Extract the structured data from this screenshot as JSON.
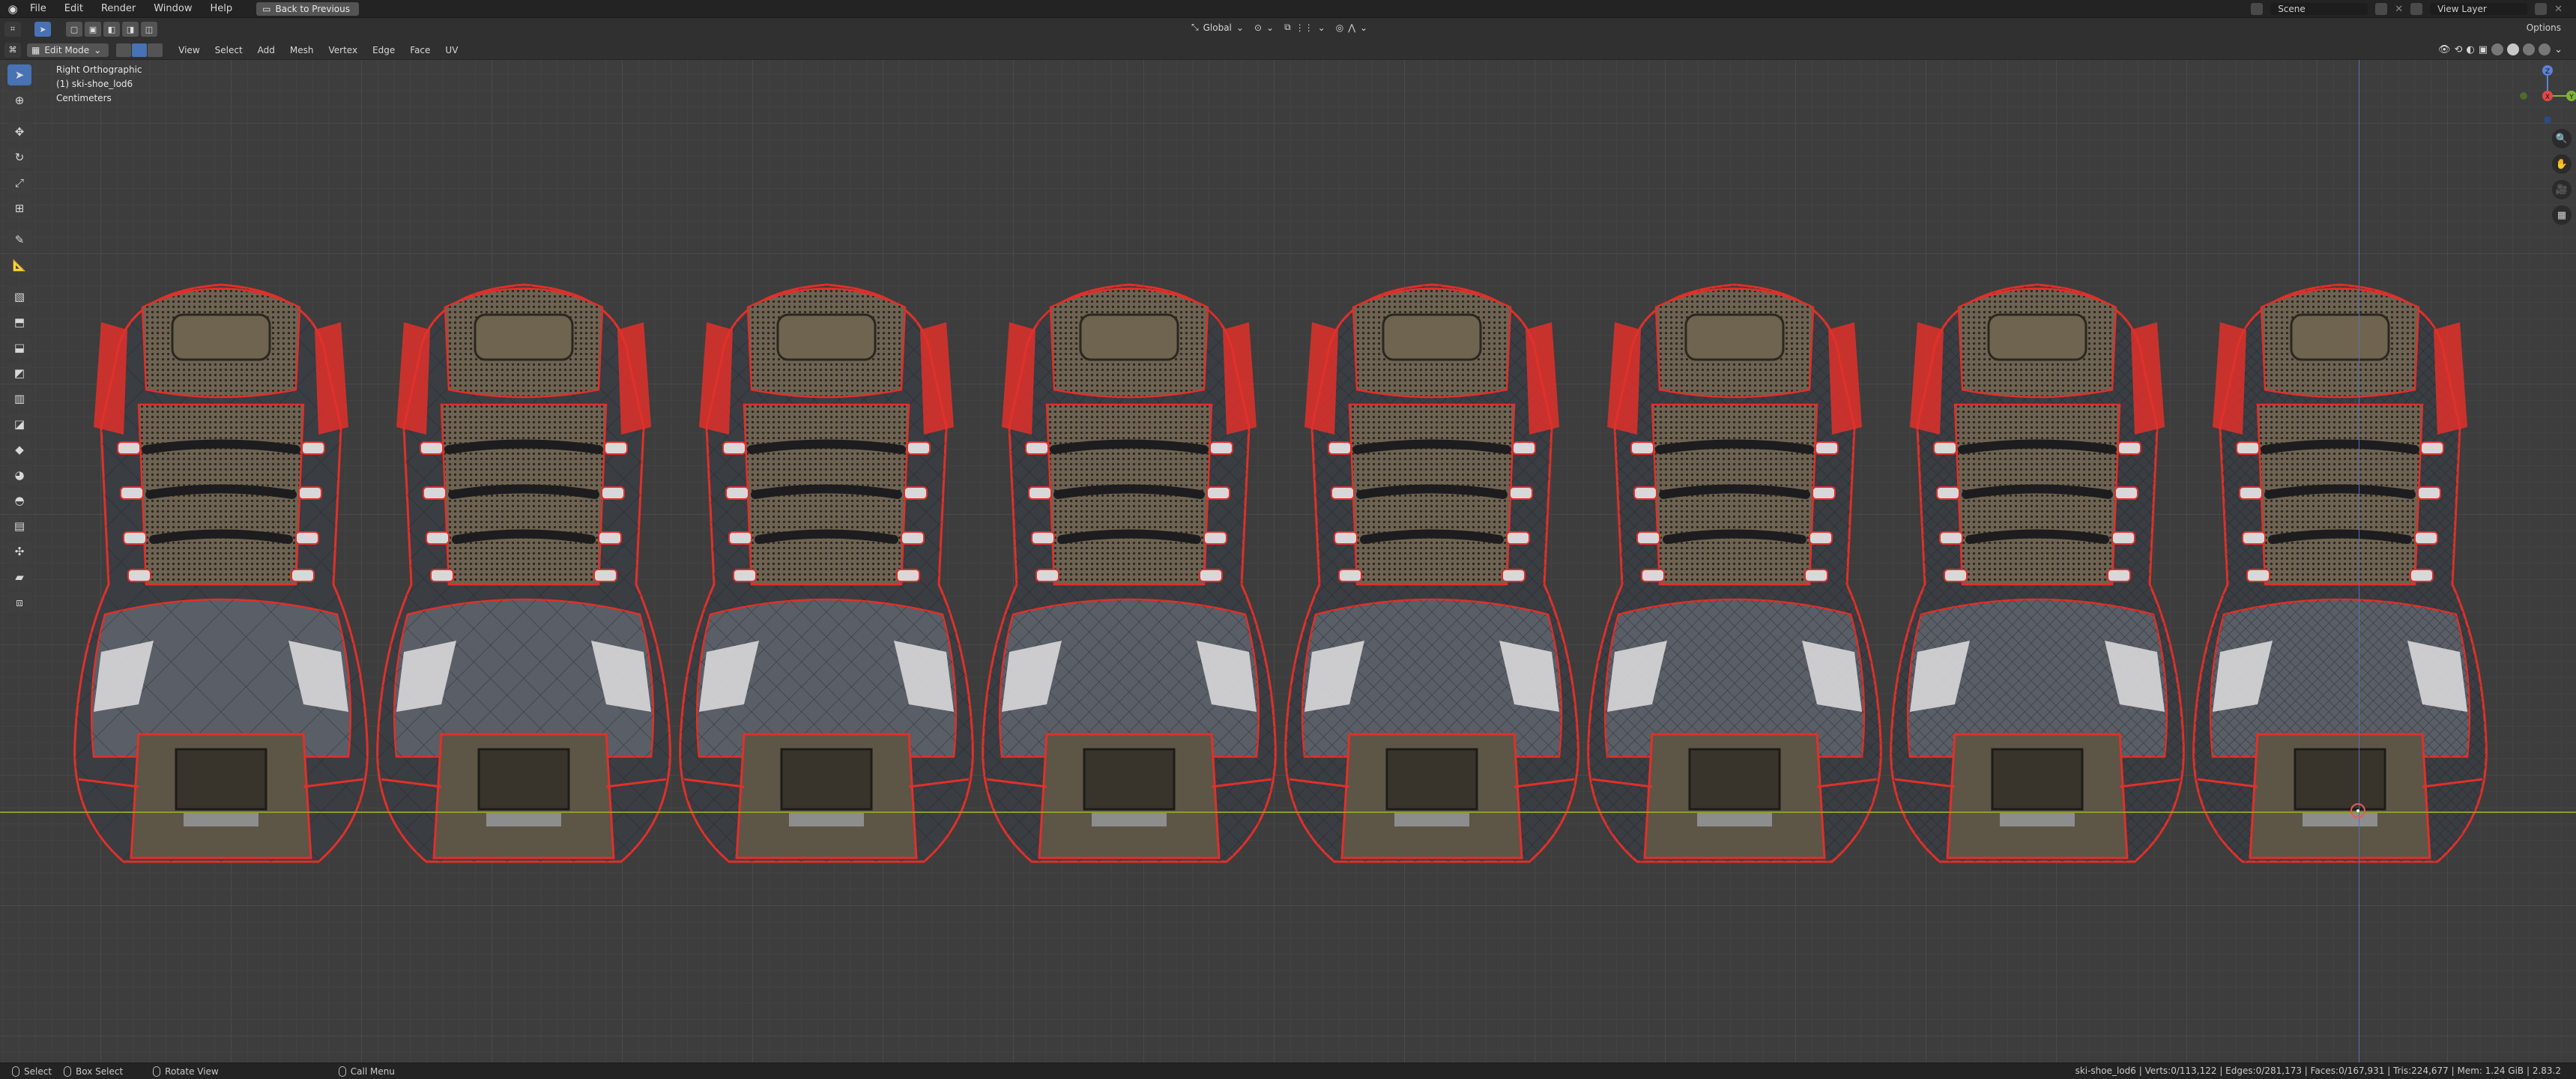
{
  "topbar": {
    "menus": [
      "File",
      "Edit",
      "Render",
      "Window",
      "Help"
    ],
    "back_button": "Back to Previous",
    "scene_label": "Scene",
    "view_layer_label": "View Layer"
  },
  "header1": {
    "transform_orientation": "Global",
    "options_label": "Options"
  },
  "header2": {
    "mode_label": "Edit Mode",
    "menus": [
      "View",
      "Select",
      "Add",
      "Mesh",
      "Vertex",
      "Edge",
      "Face",
      "UV"
    ]
  },
  "viewport": {
    "view_name": "Right Orthographic",
    "object_name": "(1) ski-shoe_lod6",
    "units": "Centimeters"
  },
  "gizmo": {
    "x_label": "X",
    "y_label": "Y",
    "z_label": "Z"
  },
  "shoes": {
    "lod_count": 8,
    "colors": {
      "mesh_dark": "#3a3d42",
      "mesh_mid": "#5a5e66",
      "seam": "#e0302a",
      "mesh_net": "#6e6352",
      "stripe": "#d8d8da"
    }
  },
  "statusbar": {
    "select_label": "Select",
    "box_select_label": "Box Select",
    "rotate_label": "Rotate View",
    "call_menu_label": "Call Menu",
    "stats": "ski-shoe_lod6 | Verts:0/113,122 | Edges:0/281,173 | Faces:0/167,931 | Tris:224,677 | Mem: 1.24 GiB | 2.83.2"
  }
}
